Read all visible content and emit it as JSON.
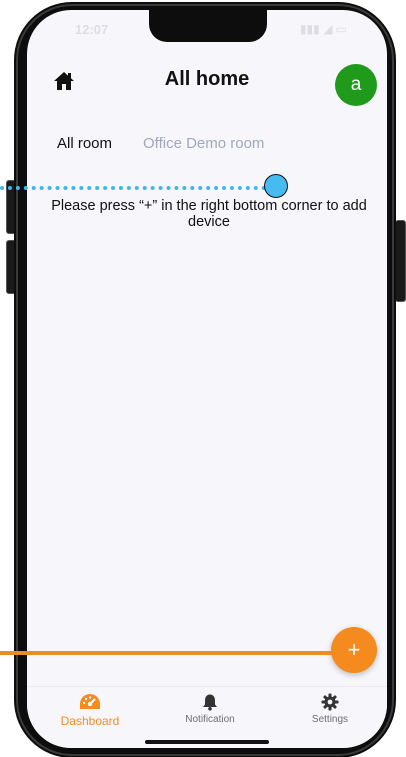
{
  "status_bar": {
    "time": "12:07",
    "icons": "▮▮▮ ◢ ▭"
  },
  "header": {
    "title": "All home",
    "home_icon": "home-icon",
    "avatar_letter": "a",
    "avatar_color": "#1f9a1a"
  },
  "tabs": [
    {
      "label": "All room",
      "active": true
    },
    {
      "label": "Office Demo room",
      "active": false
    }
  ],
  "empty_hint": "Please press “+” in the right bottom corner to add device",
  "fab": {
    "label": "+",
    "color": "#f58a1f"
  },
  "bottom_nav": [
    {
      "label": "Dashboard",
      "icon": "dashboard-gauge-icon",
      "active": true
    },
    {
      "label": "Notification",
      "icon": "bell-icon",
      "active": false
    },
    {
      "label": "Settings",
      "icon": "gear-icon",
      "active": false
    }
  ],
  "colors": {
    "accent": "#f58a1f",
    "annotation_blue": "#46bbf0",
    "annotation_orange": "#f08a23"
  }
}
